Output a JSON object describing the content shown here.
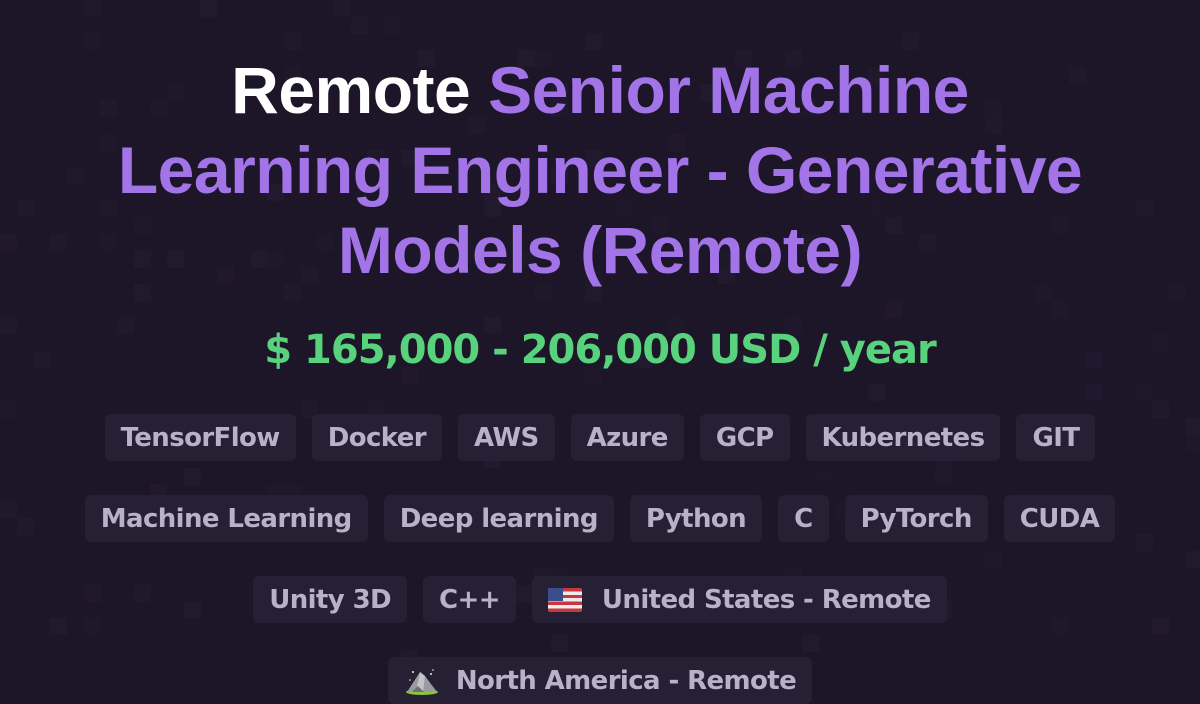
{
  "title": {
    "lead": "Remote",
    "rest": "Senior Machine Learning Engineer - Generative Models (Remote)"
  },
  "salary": "$ 165,000 - 206,000 USD / year",
  "colors": {
    "background": "#1c1628",
    "title_lead": "#ffffff",
    "title_accent": "#a374e8",
    "salary": "#58d27c",
    "tag_bg": "#262035",
    "tag_text": "#b8b2c6"
  },
  "tags": [
    [
      "TensorFlow",
      "Docker",
      "AWS",
      "Azure",
      "GCP",
      "Kubernetes",
      "GIT"
    ],
    [
      "Machine Learning",
      "Deep learning",
      "Python",
      "C",
      "PyTorch",
      "CUDA"
    ],
    [
      "Unity 3D",
      "C++"
    ]
  ],
  "locations": [
    {
      "icon": "us-flag-icon",
      "label": "United States - Remote"
    },
    {
      "icon": "mountain-icon",
      "label": "North America - Remote"
    }
  ]
}
